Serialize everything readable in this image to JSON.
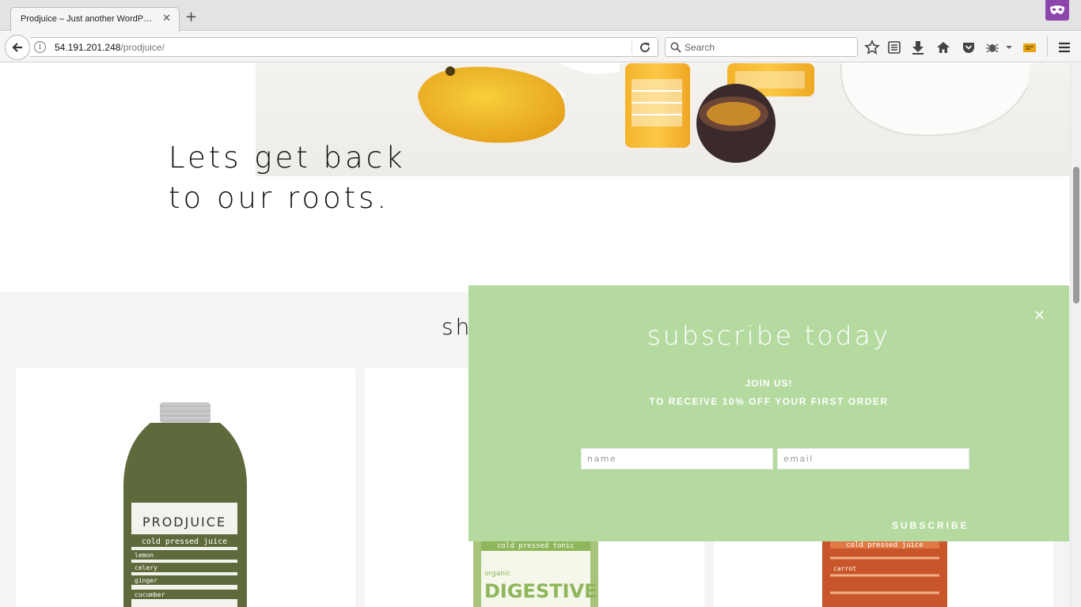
{
  "browser": {
    "tab_title": "Prodjuice – Just another WordP…",
    "tab_close": "✕",
    "new_tab": "+",
    "url_host": "54.191.201.248",
    "url_path": "/prodjuice/",
    "search_placeholder": "Search"
  },
  "hero": {
    "line1": "Lets get back",
    "line2": "to our roots."
  },
  "shop": {
    "heading_partial": "sh",
    "products": [
      {
        "brand": "PRODJUICE",
        "subtitle": "cold pressed juice",
        "ingredients": [
          "lemon",
          "celery",
          "ginger",
          "cucumber"
        ],
        "bottle_color": "#5f6a3c"
      },
      {
        "subtitle": "cold pressed tonic",
        "name_small": "organic",
        "name_large": "DIGESTIVE",
        "bottle_color": "#a8c47a"
      },
      {
        "subtitle": "cold pressed juice",
        "ingredients": [
          "carrot"
        ],
        "bottle_color": "#c8562a"
      }
    ]
  },
  "popup": {
    "close": "✕",
    "title": "subscribe today",
    "join": "JOIN US!",
    "offer": "TO RECEIVE 10% OFF YOUR FIRST ORDER",
    "name_placeholder": "name",
    "email_placeholder": "email",
    "subscribe_label": "SUBSCRIBE",
    "background_color": "#b4daa0"
  }
}
